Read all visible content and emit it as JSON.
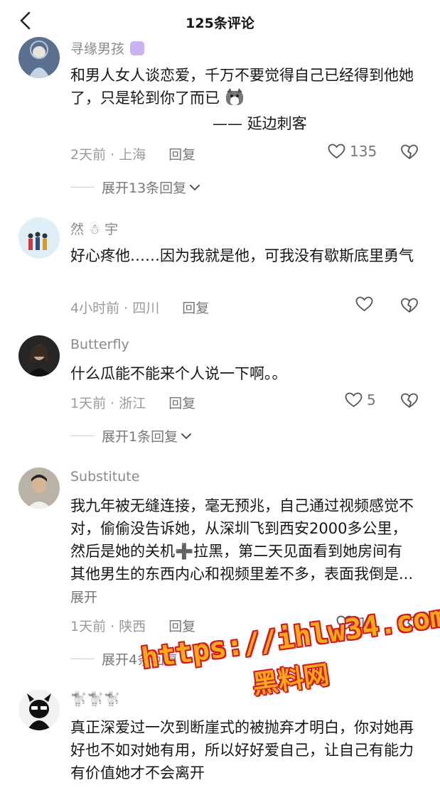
{
  "header": {
    "title": "125条评论"
  },
  "comments": [
    {
      "username": "寻缘男孩",
      "text": "和男人女人谈恋爱，千万不要觉得自己已经得到他她了，只是轮到你了而已",
      "quote": "—— 延边刺客",
      "time": "2天前",
      "location": "上海",
      "reply": "回复",
      "likes": "135",
      "expand": "展开13条回复"
    },
    {
      "username": "然 ☃ 宇",
      "text": "好心疼他……因为我就是他，可我没有歇斯底里勇气",
      "time": "4小时前",
      "location": "四川",
      "reply": "回复",
      "likes": ""
    },
    {
      "username": "Butterfly",
      "text": "什么瓜能不能来个人说一下啊。。",
      "time": "1天前",
      "location": "浙江",
      "reply": "回复",
      "likes": "5",
      "expand": "展开1条回复"
    },
    {
      "username": "Substitute",
      "text": "我九年被无缝连接，毫无预兆，自己通过视频感觉不对，偷偷没告诉她，从深圳飞到西安2000多公里，然后是她的关机➕拉黑，第二天见面看到她房间有其他男生的东西内心和视频里差不多，表面我倒是...",
      "more": "展开",
      "time": "1天前",
      "location": "陕西",
      "reply": "回复",
      "likes": "18",
      "expand": "展开4条回复"
    },
    {
      "username": "🐩🐩🐩",
      "text": "真正深爱过一次到断崖式的被抛弃才明白，你对她再好也不如对她有用，所以好好爱自己，让自己有能力有价值她才不会离开"
    }
  ],
  "watermark": {
    "url": "https://ihlw34.com",
    "name": "黑料网"
  },
  "colors": {
    "watermark_fill": "#f7a81b",
    "watermark_stroke": "#d2191f",
    "meta": "#9a9a9a"
  }
}
